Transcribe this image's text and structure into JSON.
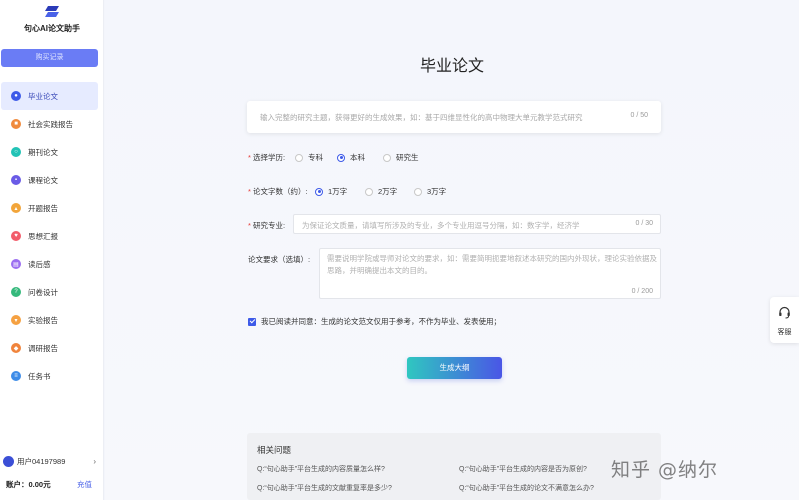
{
  "sidebar": {
    "app_name": "句心AI论文助手",
    "history_button": "购买记录",
    "items": [
      {
        "label": "毕业论文",
        "color": "#3d5ae8",
        "active": true
      },
      {
        "label": "社会实践报告",
        "color": "#f08a3c"
      },
      {
        "label": "期刊论文",
        "color": "#22c3b6"
      },
      {
        "label": "课程论文",
        "color": "#6a5be6"
      },
      {
        "label": "开题报告",
        "color": "#f2a53a"
      },
      {
        "label": "思想汇报",
        "color": "#f25c6a"
      },
      {
        "label": "读后感",
        "color": "#9b6ef0"
      },
      {
        "label": "问卷设计",
        "color": "#35b97c"
      },
      {
        "label": "实验报告",
        "color": "#f5a142"
      },
      {
        "label": "调研报告",
        "color": "#f0843c"
      },
      {
        "label": "任务书",
        "color": "#3d8ce8"
      }
    ],
    "user_name": "用户04197989",
    "balance": "账户：0.00元",
    "recharge": "充值"
  },
  "main": {
    "title": "毕业论文",
    "topic": {
      "placeholder": "输入完整的研究主题，获得更好的生成效果，如：基于四维显性化的高中物理大单元教学范式研究",
      "count": "0 / 50"
    },
    "education": {
      "label": "选择学历:",
      "options": [
        "专科",
        "本科",
        "研究生"
      ],
      "selected": "本科"
    },
    "word_count": {
      "label": "论文字数（约）:",
      "options": [
        "1万字",
        "2万字",
        "3万字"
      ],
      "selected": "1万字"
    },
    "major": {
      "label": "研究专业:",
      "placeholder": "为保证论文质量，请填写所涉及的专业，多个专业用逗号分隔，如：数字学，经济学",
      "count": "0 / 30"
    },
    "requirements": {
      "label": "论文要求（选填）:",
      "placeholder": "需要说明学院或导师对论文的要求，如：需要简明扼要地叙述本研究的国内外现状，理论实验依据及思路，并明确提出本文的目的。",
      "count": "0 / 200"
    },
    "agreement": "我已阅读并同意：生成的论文范文仅用于参考，不作为毕业、发表使用；",
    "generate_button": "生成大纲",
    "faq": {
      "title": "相关问题",
      "questions": [
        "Q:“句心助手”平台生成的内容质量怎么样?",
        "Q:“句心助手”平台生成的内容是否为原创?",
        "Q:“句心助手”平台生成的文献重复率是多少?",
        "Q:“句心助手”平台生成的论文不满意怎么办?"
      ]
    }
  },
  "customer_service": "客服",
  "watermark": "知乎 @纳尔"
}
